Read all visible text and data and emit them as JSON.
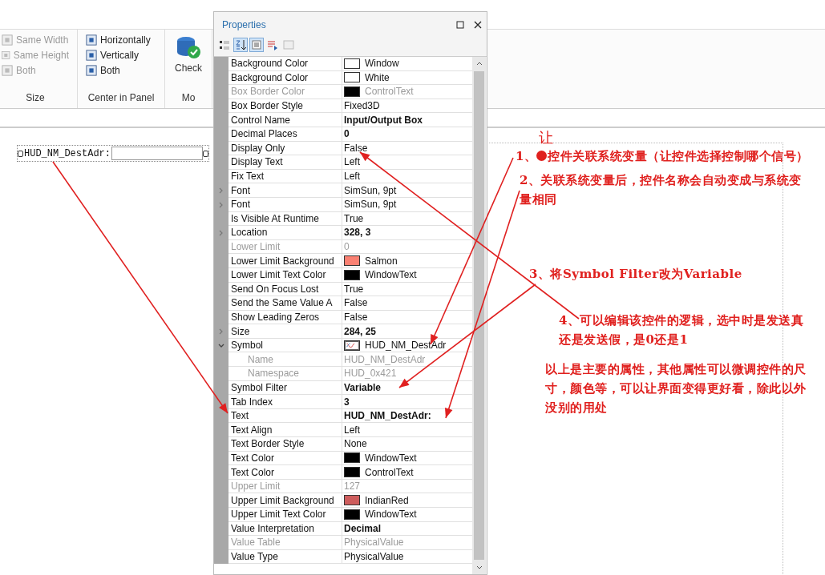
{
  "ribbon": {
    "groups": [
      {
        "label": "Size",
        "items": [
          {
            "label": "Same Width",
            "disabled": true
          },
          {
            "label": "Same Height",
            "disabled": true
          },
          {
            "label": "Both",
            "disabled": true
          }
        ]
      },
      {
        "label": "Center in Panel",
        "items": [
          {
            "label": "Horizontally",
            "disabled": false
          },
          {
            "label": "Vertically",
            "disabled": false
          },
          {
            "label": "Both",
            "disabled": false
          }
        ]
      },
      {
        "label": "Mo",
        "button": "Check"
      }
    ]
  },
  "canvas": {
    "control_label": "HUD_NM_DestAdr:"
  },
  "properties": {
    "title": "Properties",
    "rows": [
      {
        "name": "Background Color",
        "value": "Window",
        "kind": "swatch",
        "color": "#ffffff"
      },
      {
        "name": "Background Color",
        "value": "White",
        "kind": "swatch",
        "color": "#ffffff"
      },
      {
        "name": "Box Border Color",
        "value": "ControlText",
        "kind": "swatch",
        "color": "#000000",
        "disabled": true
      },
      {
        "name": "Box Border Style",
        "value": "Fixed3D"
      },
      {
        "name": "Control Name",
        "value": "Input/Output Box",
        "bold": true
      },
      {
        "name": "Decimal Places",
        "value": "0",
        "bold": true
      },
      {
        "name": "Display Only",
        "value": "False"
      },
      {
        "name": "Display Text",
        "value": "Left"
      },
      {
        "name": "Fix Text",
        "value": "Left"
      },
      {
        "name": "Font",
        "value": "SimSun, 9pt",
        "expanded": false
      },
      {
        "name": "Font",
        "value": "SimSun, 9pt",
        "expanded": false
      },
      {
        "name": "Is Visible At Runtime",
        "value": "True"
      },
      {
        "name": "Location",
        "value": "328, 3",
        "bold": true,
        "expanded": false
      },
      {
        "name": "Lower Limit",
        "value": "0",
        "disabled": true
      },
      {
        "name": "Lower Limit Background",
        "value": "Salmon",
        "kind": "swatch",
        "color": "#fa8072"
      },
      {
        "name": "Lower Limit Text Color",
        "value": "WindowText",
        "kind": "swatch",
        "color": "#000000"
      },
      {
        "name": "Send On Focus Lost",
        "value": "True"
      },
      {
        "name": "Send the Same Value A",
        "value": "False"
      },
      {
        "name": "Show Leading Zeros",
        "value": "False"
      },
      {
        "name": "Size",
        "value": "284, 25",
        "bold": true,
        "expanded": false
      },
      {
        "name": "Symbol",
        "value": "HUD_NM_DestAdr",
        "kind": "symbol",
        "expanded": true,
        "children": [
          {
            "name": "Name",
            "value": "HUD_NM_DestAdr",
            "disabled": true
          },
          {
            "name": "Namespace",
            "value": "HUD_0x421",
            "disabled": true
          }
        ]
      },
      {
        "name": "Symbol Filter",
        "value": "Variable",
        "bold": true
      },
      {
        "name": "Tab Index",
        "value": "3",
        "bold": true
      },
      {
        "name": "Text",
        "value": "HUD_NM_DestAdr:",
        "bold": true
      },
      {
        "name": "Text Align",
        "value": "Left"
      },
      {
        "name": "Text Border Style",
        "value": "None"
      },
      {
        "name": "Text Color",
        "value": "WindowText",
        "kind": "swatch",
        "color": "#000000"
      },
      {
        "name": "Text Color",
        "value": "ControlText",
        "kind": "swatch",
        "color": "#000000"
      },
      {
        "name": "Upper Limit",
        "value": "127",
        "disabled": true
      },
      {
        "name": "Upper Limit Background",
        "value": "IndianRed",
        "kind": "swatch",
        "color": "#cd5c5c"
      },
      {
        "name": "Upper Limit Text Color",
        "value": "WindowText",
        "kind": "swatch",
        "color": "#000000"
      },
      {
        "name": "Value Interpretation",
        "value": "Decimal",
        "bold": true
      },
      {
        "name": "Value Table",
        "value": "PhysicalValue",
        "disabled": true
      },
      {
        "name": "Value Type",
        "value": "PhysicalValue"
      }
    ]
  },
  "annotations": [
    {
      "kind": "mark",
      "text": "让"
    },
    {
      "kind": "note",
      "number": "1、",
      "text": "控件关联系统变量（让控件选择控制哪个信号）",
      "blot": true
    },
    {
      "kind": "note",
      "number": "2、",
      "text": "关联系统变量后，控件名称会自动变成与系统变量相同"
    },
    {
      "kind": "note",
      "number": "3、",
      "text": "将Symbol Filter改为Variable"
    },
    {
      "kind": "note",
      "number": "4、",
      "text": "可以编辑该控件的逻辑，选中时是发送真还是发送假，是0还是1"
    },
    {
      "kind": "summary",
      "text": "以上是主要的属性，其他属性可以微调控件的尺寸，颜色等，可以让界面变得更好看，除此以外没别的用处"
    }
  ]
}
